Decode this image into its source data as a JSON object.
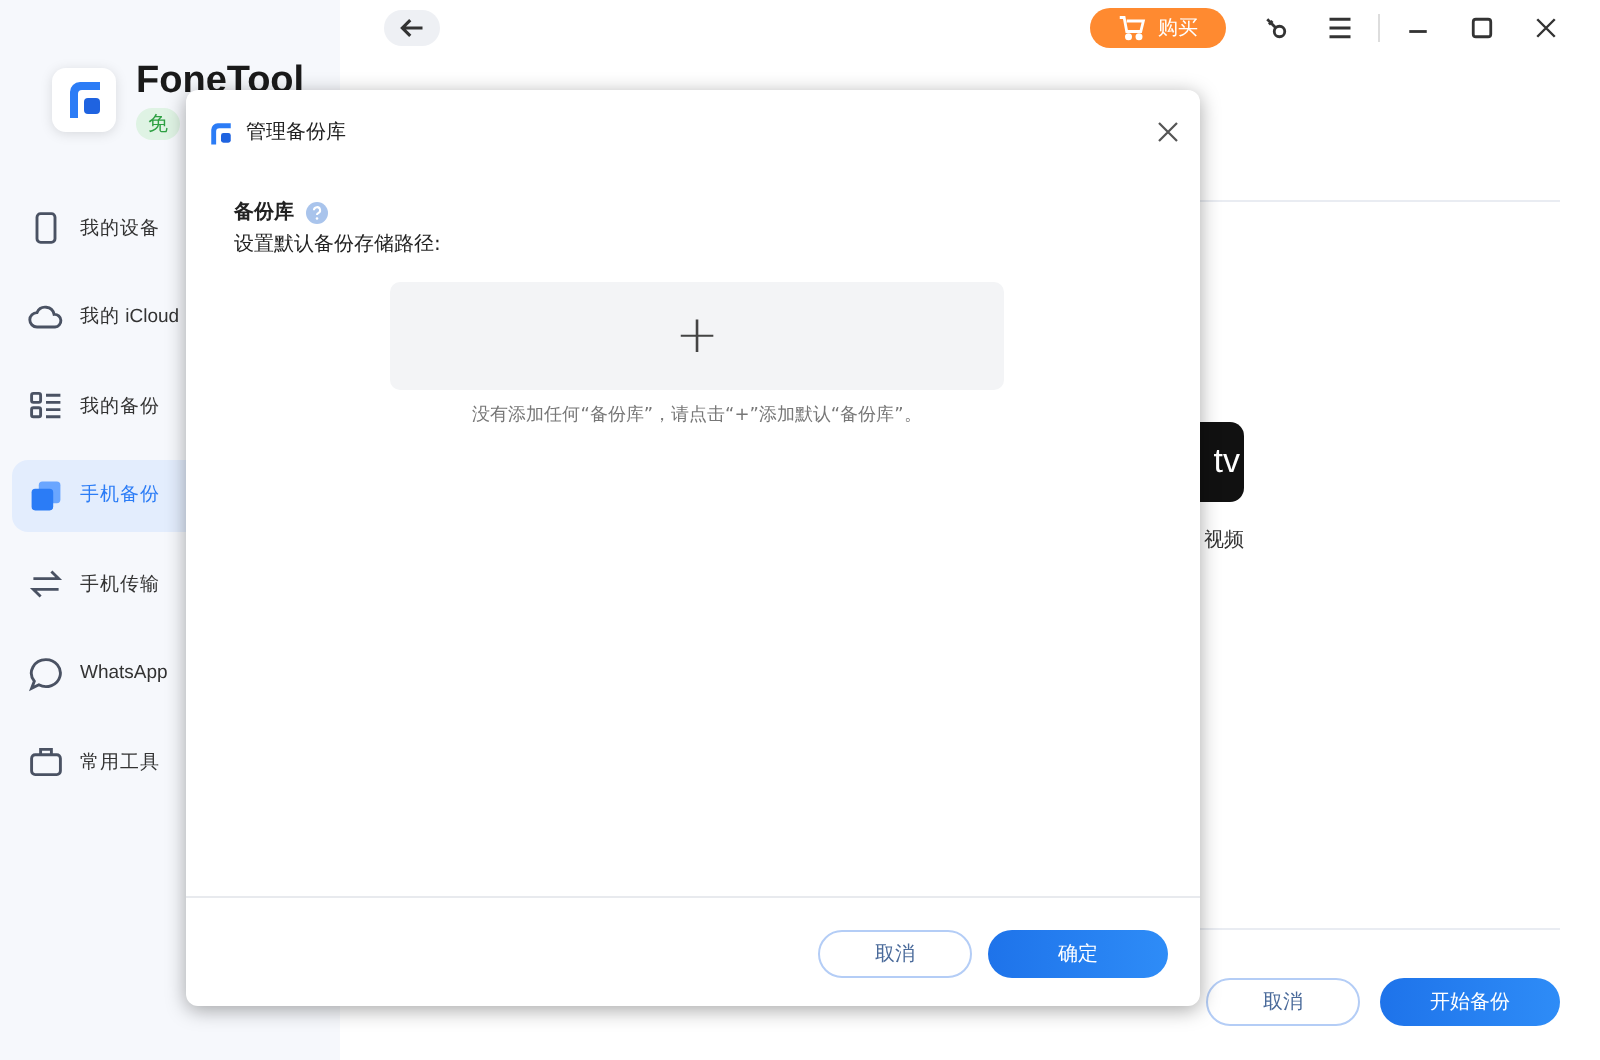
{
  "app": {
    "name": "FoneTool",
    "badge": "免"
  },
  "sidebar": {
    "items": [
      {
        "label": "我的设备",
        "selected": false
      },
      {
        "label": "我的 iCloud",
        "selected": false
      },
      {
        "label": "我的备份",
        "selected": false
      },
      {
        "label": "手机备份",
        "selected": true
      },
      {
        "label": "手机传输",
        "selected": false
      },
      {
        "label": "WhatsApp",
        "selected": false
      },
      {
        "label": "常用工具",
        "selected": false
      }
    ]
  },
  "topbar": {
    "buy_label": "购买"
  },
  "main": {
    "app_tile": {
      "icon_text": "tv",
      "label": "视频"
    },
    "buttons": {
      "cancel": "取消",
      "start": "开始备份"
    }
  },
  "dialog": {
    "title": "管理备份库",
    "section_label": "备份库",
    "subtitle": "设置默认备份存储路径:",
    "add_symbol": "+",
    "empty_hint": "没有添加任何“备份库”，请点击“+”添加默认“备份库”。",
    "cancel": "取消",
    "ok": "确定"
  }
}
